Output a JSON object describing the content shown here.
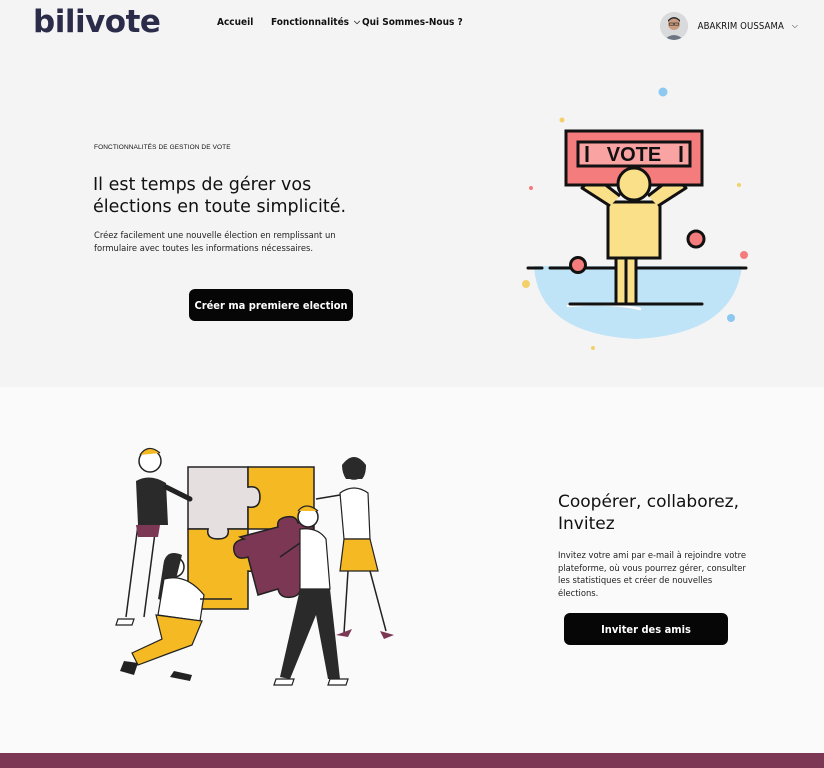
{
  "brand": {
    "logo_text": "bilivote"
  },
  "nav": {
    "items": [
      {
        "label": "Accueil",
        "has_dropdown": false
      },
      {
        "label": "Fonctionnalités",
        "has_dropdown": true
      },
      {
        "label": "Qui Sommes-Nous ?",
        "has_dropdown": false
      }
    ],
    "user": {
      "name": "ABAKRIM OUSSAMA",
      "icon": "chevron-down-icon"
    }
  },
  "hero": {
    "eyebrow": "FONCTIONNALITÉS DE GESTION DE VOTE",
    "title": "Il est temps de gérer vos élections en toute simplicité.",
    "description": "Créez facilement une nouvelle élection en remplissant un formulaire avec toutes les informations nécessaires.",
    "button_label": "Créer ma premiere election",
    "illustration": {
      "sign_text": "VOTE"
    }
  },
  "cooperate": {
    "title": "Coopérer, collaborez, Invitez",
    "description": "Invitez votre ami par e-mail à rejoindre votre plateforme, où vous pourrez gérer, consulter les statistiques et créer de nouvelles élections.",
    "button_label": "Inviter des amis"
  },
  "colors": {
    "brand_text": "#2b2b4a",
    "button_bg": "#060606",
    "accent_maroon": "#7c3755",
    "vote_sign": "#f47c7c",
    "figure_yellow": "#fbe08a",
    "puzzle_yellow": "#f4b923",
    "light_blue": "#bfe3f7"
  }
}
